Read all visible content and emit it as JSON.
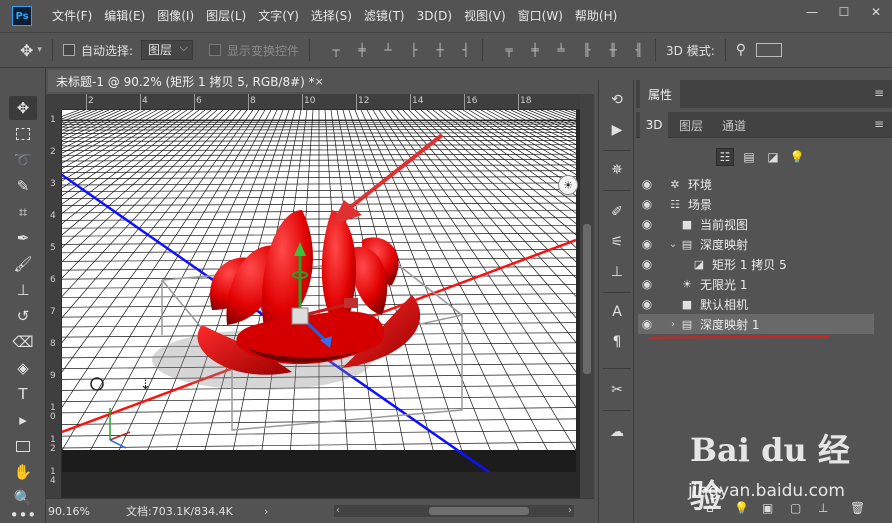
{
  "app": {
    "logo": "Ps"
  },
  "menu": [
    "文件(F)",
    "编辑(E)",
    "图像(I)",
    "图层(L)",
    "文字(Y)",
    "选择(S)",
    "滤镜(T)",
    "3D(D)",
    "视图(V)",
    "窗口(W)",
    "帮助(H)"
  ],
  "window_controls": {
    "minimize": "—",
    "restore": "☐",
    "close": "✕"
  },
  "options": {
    "move_icon": "✥",
    "auto_select_label": "自动选择:",
    "auto_select_value": "图层",
    "show_transform_label": "显示变换控件",
    "mode_label": "3D 模式:"
  },
  "document": {
    "tab_title": "未标题-1 @ 90.2% (矩形 1 拷贝 5, RGB/8#) *",
    "close": "×",
    "ruler_h_ticks": [
      "2",
      "4",
      "6",
      "8",
      "10",
      "12",
      "14",
      "16",
      "18"
    ],
    "ruler_v_ticks": [
      "1",
      "2",
      "3",
      "4",
      "5",
      "6",
      "7",
      "8",
      "9",
      "1\n0",
      "1\n2",
      "1\n4"
    ],
    "zoom": "90.16%",
    "doc_info": "文档:703.1K/834.4K"
  },
  "panel": {
    "title": "属性",
    "menu_icon": "≡",
    "tabs": [
      "3D",
      "图层",
      "通道"
    ],
    "layers": [
      {
        "name": "环境",
        "icon": "env-icon",
        "indent": 0,
        "chevron": ""
      },
      {
        "name": "场景",
        "icon": "scene-icon",
        "indent": 0,
        "chevron": ""
      },
      {
        "name": "当前视图",
        "icon": "camera-icon",
        "indent": 1,
        "chevron": ""
      },
      {
        "name": "深度映射",
        "icon": "mesh-icon",
        "indent": 1,
        "chevron": "⌄"
      },
      {
        "name": "矩形 1 拷贝 5",
        "icon": "material-icon",
        "indent": 2,
        "chevron": ""
      },
      {
        "name": "无限光 1",
        "icon": "light-icon",
        "indent": 1,
        "chevron": ""
      },
      {
        "name": "默认相机",
        "icon": "camera-icon",
        "indent": 1,
        "chevron": ""
      },
      {
        "name": "深度映射 1",
        "icon": "mesh-icon",
        "indent": 1,
        "chevron": "›",
        "selected": true
      }
    ]
  },
  "watermark": {
    "logo": "Bai du 经验",
    "url": "jingyan.baidu.com"
  }
}
